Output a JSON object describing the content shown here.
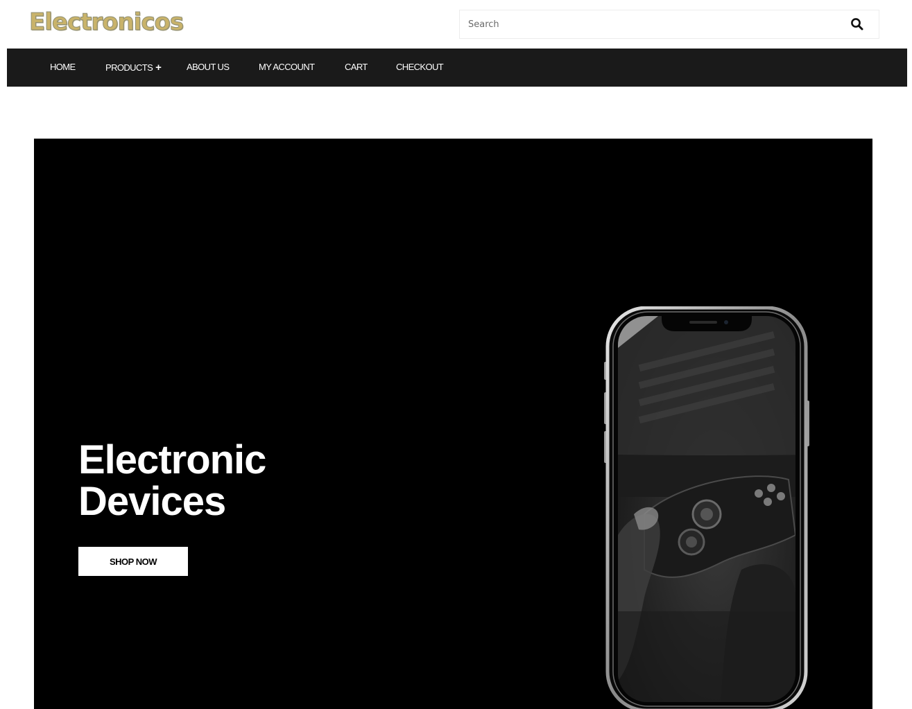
{
  "header": {
    "logo_text": "Electronicos",
    "logo_color": "#c9b36a",
    "search": {
      "placeholder": "Search",
      "value": "",
      "icon": "search-icon"
    }
  },
  "nav": {
    "background": "#1a1a1a",
    "items": [
      {
        "label": "HOME"
      },
      {
        "label": "PRODUCTS",
        "suffix": "+"
      },
      {
        "label": "ABOUT US"
      },
      {
        "label": "MY ACCOUNT"
      },
      {
        "label": "CART"
      },
      {
        "label": "CHECKOUT"
      }
    ]
  },
  "hero": {
    "background": "#000000",
    "title_line1": "Electronic",
    "title_line2": "Devices",
    "button_label": "SHOP NOW",
    "image": "smartphone-showing-game-controller"
  }
}
